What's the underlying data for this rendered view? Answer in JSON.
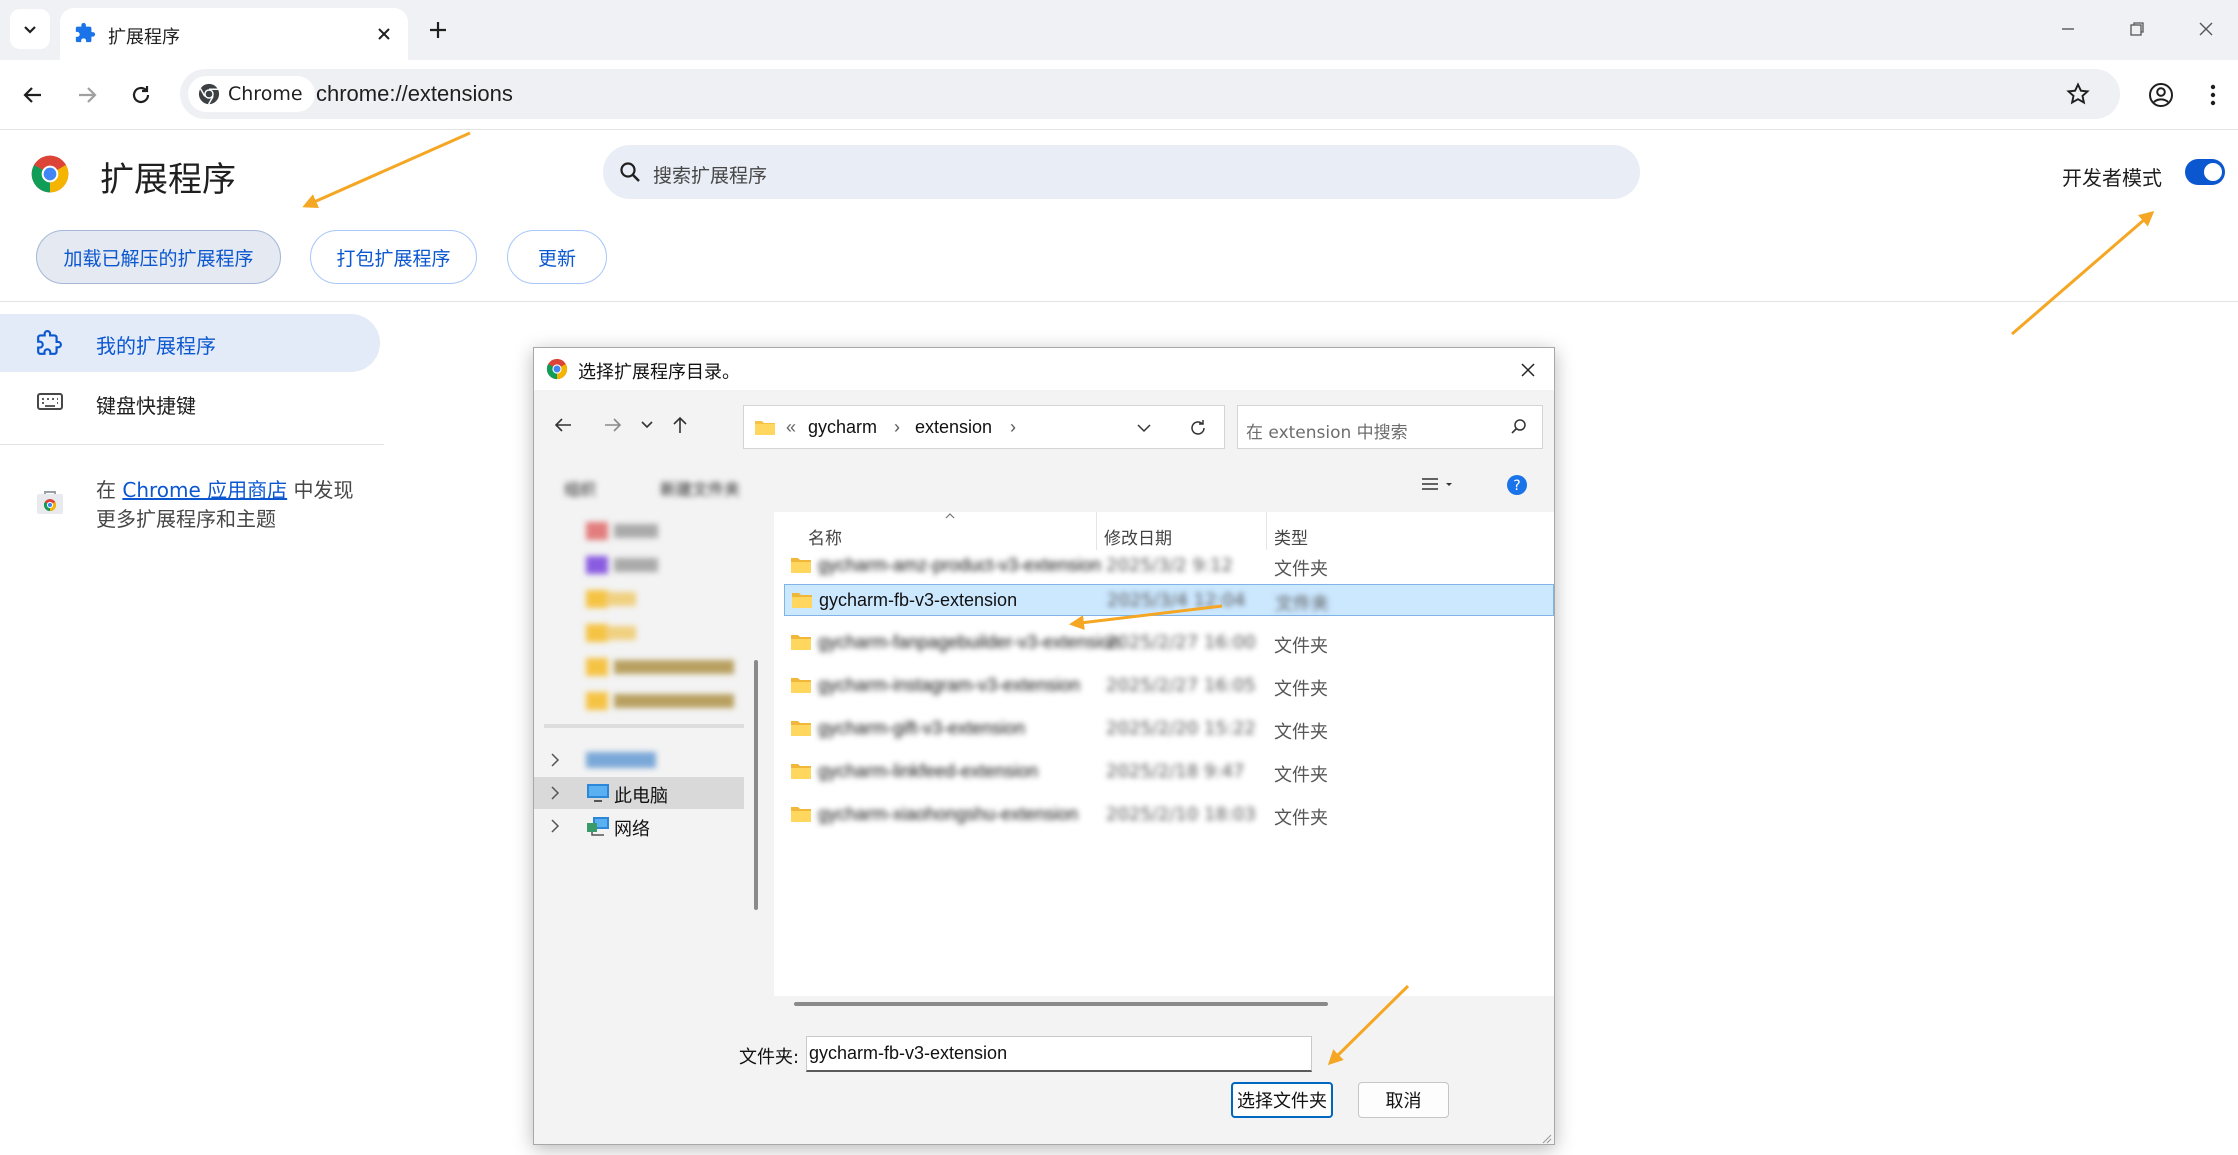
{
  "browser": {
    "tab_title": "扩展程序",
    "chip_label": "Chrome",
    "url": "chrome://extensions"
  },
  "page": {
    "title": "扩展程序",
    "search_placeholder": "搜索扩展程序",
    "dev_mode_label": "开发者模式",
    "dev_mode_on": true,
    "actions": {
      "load_unpacked": "加载已解压的扩展程序",
      "pack": "打包扩展程序",
      "update": "更新"
    },
    "sidebar": {
      "my_extensions": "我的扩展程序",
      "shortcuts": "键盘快捷键",
      "store_prefix": "在 ",
      "store_link": "Chrome 应用商店",
      "store_suffix": " 中发现更多扩展程序和主题"
    }
  },
  "dialog": {
    "title": "选择扩展程序目录。",
    "breadcrumb": [
      "gycharm",
      "extension"
    ],
    "breadcrumb_overflow": "«",
    "search_placeholder": "在 extension 中搜索",
    "commands": {
      "organize": "组织",
      "new_folder": "新建文件夹"
    },
    "columns": {
      "name": "名称",
      "date": "修改日期",
      "type": "类型"
    },
    "rows": [
      {
        "name": "gycharm-amz-product-v3-extension",
        "date": "2025/3/2 9:12",
        "type": "文件夹",
        "blur": true
      },
      {
        "name": "gycharm-fb-v3-extension",
        "date": "2025/3/4 12:04",
        "type": "文件夹",
        "selected": true
      },
      {
        "name": "gycharm-fanpagebuilder-v3-extension",
        "date": "2025/2/27 16:00",
        "type": "文件夹",
        "blur": true
      },
      {
        "name": "gycharm-instagram-v3-extension",
        "date": "2025/2/27 16:05",
        "type": "文件夹",
        "blur": true
      },
      {
        "name": "gycharm-gift-v3-extension",
        "date": "2025/2/20 15:22",
        "type": "文件夹",
        "blur": true
      },
      {
        "name": "gycharm-linkfeed-extension",
        "date": "2025/2/18 9:47",
        "type": "文件夹",
        "blur": true
      },
      {
        "name": "gycharm-xiaohongshu-extension",
        "date": "2025/2/10 18:03",
        "type": "文件夹",
        "blur": true
      }
    ],
    "tree": {
      "this_pc": "此电脑",
      "network": "网络"
    },
    "folder_label": "文件夹:",
    "folder_value": "gycharm-fb-v3-extension",
    "select_button": "选择文件夹",
    "cancel_button": "取消"
  },
  "colors": {
    "accent": "#0b57d0",
    "annotation_arrow": "#f5a623",
    "selection": "#cce8ff"
  }
}
